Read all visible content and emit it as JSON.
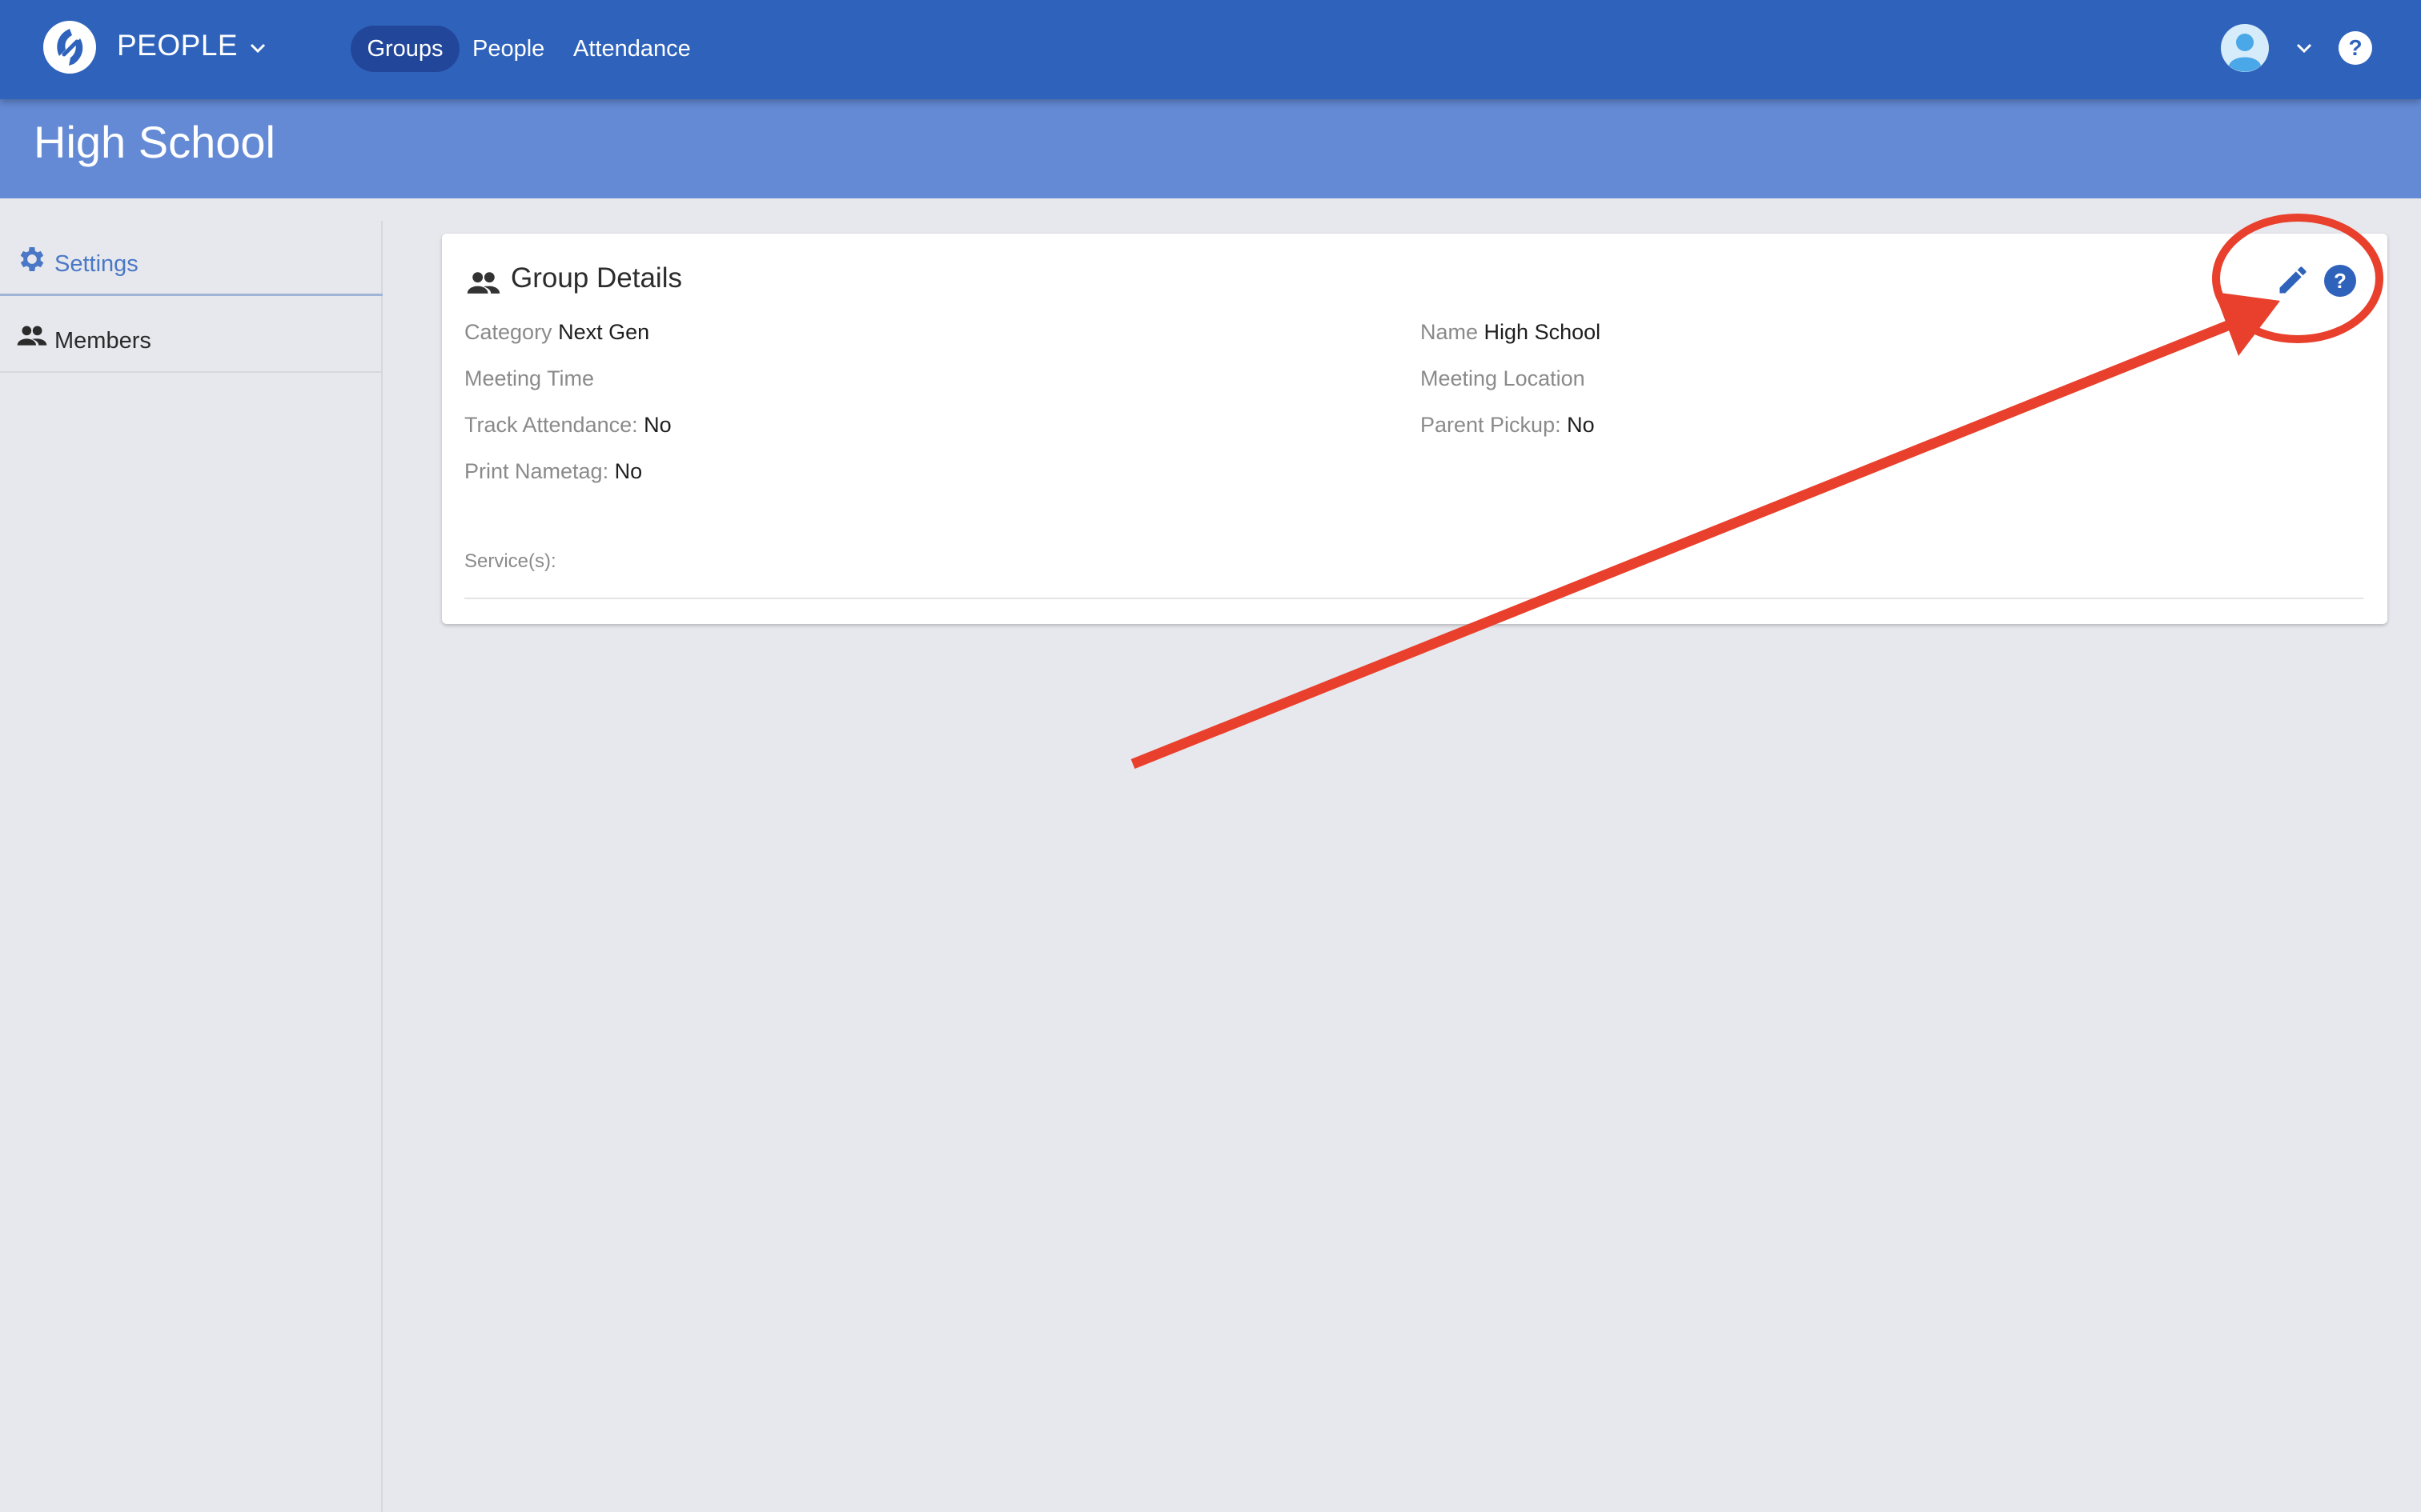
{
  "app": {
    "name": "PEOPLE"
  },
  "nav": {
    "items": [
      "Groups",
      "People",
      "Attendance"
    ],
    "active": "Groups"
  },
  "page": {
    "title": "High School"
  },
  "sidebar": {
    "items": [
      {
        "label": "Settings",
        "icon": "gear-icon",
        "active": true
      },
      {
        "label": "Members",
        "icon": "people-icon",
        "active": false
      }
    ]
  },
  "card": {
    "title": "Group Details",
    "fields": {
      "category": {
        "key": "Category",
        "value": "Next Gen"
      },
      "name": {
        "key": "Name",
        "value": "High School"
      },
      "meeting_time": {
        "key": "Meeting Time",
        "value": ""
      },
      "meeting_location": {
        "key": "Meeting Location",
        "value": ""
      },
      "track_attendance": {
        "key": "Track Attendance:",
        "value": "No"
      },
      "parent_pickup": {
        "key": "Parent Pickup:",
        "value": "No"
      },
      "print_nametag": {
        "key": "Print Nametag:",
        "value": "No"
      }
    },
    "services_label": "Service(s):"
  },
  "colors": {
    "topbar": "#2f63bb",
    "subheader": "#648ad5",
    "accent": "#2f63bb",
    "annotation": "#e8402c"
  }
}
